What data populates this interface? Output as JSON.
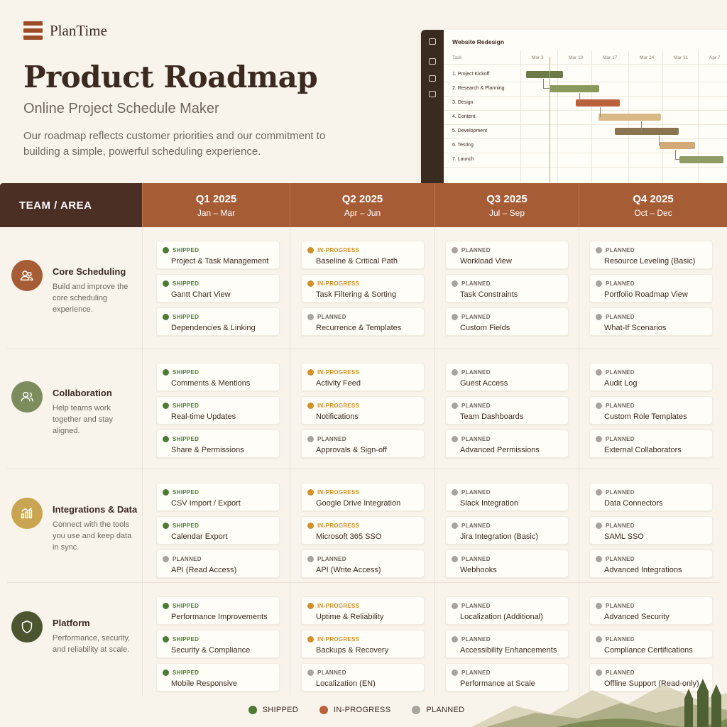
{
  "brand": {
    "name": "PlanTime"
  },
  "hero": {
    "title": "Product Roadmap",
    "subtitle": "Online Project Schedule Maker",
    "description": "Our roadmap reflects customer priorities and our commitment to building a simple, powerful scheduling experience."
  },
  "preview": {
    "title": "Website Redesign",
    "column_header": "Task",
    "dates": [
      "Mar 3",
      "Mar 10",
      "Mar 17",
      "Mar 24",
      "Mar 31",
      "Apr 7"
    ],
    "tasks": [
      "1. Project Kickoff",
      "2. Research & Planning",
      "3. Design",
      "4. Content",
      "5. Development",
      "6. Testing",
      "7. Launch"
    ],
    "bar_colors": [
      "#6d7a45",
      "#8b9a5c",
      "#b8613a",
      "#d9b985",
      "#8a744f",
      "#d4a97a",
      "#8f9c66"
    ]
  },
  "table": {
    "team_header": "TEAM / AREA",
    "quarters": [
      {
        "name": "Q1 2025",
        "range": "Jan – Mar"
      },
      {
        "name": "Q2 2025",
        "range": "Apr – Jun"
      },
      {
        "name": "Q3 2025",
        "range": "Jul – Sep"
      },
      {
        "name": "Q4 2025",
        "range": "Oct – Dec"
      }
    ],
    "areas": [
      {
        "name": "Core Scheduling",
        "desc": "Build and improve the core scheduling experience.",
        "icon": "team-icon",
        "color": "#a65d36",
        "items": [
          [
            {
              "s": "SHIPPED",
              "t": "Project & Task Management"
            },
            {
              "s": "SHIPPED",
              "t": "Gantt Chart View"
            },
            {
              "s": "SHIPPED",
              "t": "Dependencies & Linking"
            }
          ],
          [
            {
              "s": "IN-PROGRESS",
              "t": "Baseline & Critical Path"
            },
            {
              "s": "IN-PROGRESS",
              "t": "Task Filtering & Sorting"
            },
            {
              "s": "PLANNED",
              "t": "Recurrence & Templates"
            }
          ],
          [
            {
              "s": "PLANNED",
              "t": "Workload View"
            },
            {
              "s": "PLANNED",
              "t": "Task Constraints"
            },
            {
              "s": "PLANNED",
              "t": "Custom Fields"
            }
          ],
          [
            {
              "s": "PLANNED",
              "t": "Resource Leveling (Basic)"
            },
            {
              "s": "PLANNED",
              "t": "Portfolio Roadmap View"
            },
            {
              "s": "PLANNED",
              "t": "What-If Scenarios"
            }
          ]
        ]
      },
      {
        "name": "Collaboration",
        "desc": "Help teams work together and stay aligned.",
        "icon": "people-icon",
        "color": "#7c8c5c",
        "items": [
          [
            {
              "s": "SHIPPED",
              "t": "Comments & Mentions"
            },
            {
              "s": "SHIPPED",
              "t": "Real-time Updates"
            },
            {
              "s": "SHIPPED",
              "t": "Share & Permissions"
            }
          ],
          [
            {
              "s": "IN-PROGRESS",
              "t": "Activity Feed"
            },
            {
              "s": "IN-PROGRESS",
              "t": "Notifications"
            },
            {
              "s": "PLANNED",
              "t": "Approvals & Sign-off"
            }
          ],
          [
            {
              "s": "PLANNED",
              "t": "Guest Access"
            },
            {
              "s": "PLANNED",
              "t": "Team Dashboards"
            },
            {
              "s": "PLANNED",
              "t": "Advanced Permissions"
            }
          ],
          [
            {
              "s": "PLANNED",
              "t": "Audit Log"
            },
            {
              "s": "PLANNED",
              "t": "Custom Role Templates"
            },
            {
              "s": "PLANNED",
              "t": "External Collaborators"
            }
          ]
        ]
      },
      {
        "name": "Integrations & Data",
        "desc": "Connect with the tools you use and keep data in sync.",
        "icon": "chart-icon",
        "color": "#c9a552",
        "items": [
          [
            {
              "s": "SHIPPED",
              "t": "CSV Import / Export"
            },
            {
              "s": "SHIPPED",
              "t": "Calendar Export"
            },
            {
              "s": "PLANNED",
              "t": "API (Read Access)"
            }
          ],
          [
            {
              "s": "IN-PROGRESS",
              "t": "Google Drive Integration"
            },
            {
              "s": "IN-PROGRESS",
              "t": "Microsoft 365 SSO"
            },
            {
              "s": "PLANNED",
              "t": "API (Write Access)"
            }
          ],
          [
            {
              "s": "PLANNED",
              "t": "Slack Integration"
            },
            {
              "s": "PLANNED",
              "t": "Jira Integration (Basic)"
            },
            {
              "s": "PLANNED",
              "t": "Webhooks"
            }
          ],
          [
            {
              "s": "PLANNED",
              "t": "Data Connectors"
            },
            {
              "s": "PLANNED",
              "t": "SAML SSO"
            },
            {
              "s": "PLANNED",
              "t": "Advanced Integrations"
            }
          ]
        ]
      },
      {
        "name": "Platform",
        "desc": "Performance, security, and reliability at scale.",
        "icon": "shield-icon",
        "color": "#4b5530",
        "items": [
          [
            {
              "s": "SHIPPED",
              "t": "Performance Improvements"
            },
            {
              "s": "SHIPPED",
              "t": "Security & Compliance"
            },
            {
              "s": "SHIPPED",
              "t": "Mobile Responsive"
            }
          ],
          [
            {
              "s": "IN-PROGRESS",
              "t": "Uptime & Reliability"
            },
            {
              "s": "IN-PROGRESS",
              "t": "Backups & Recovery"
            },
            {
              "s": "PLANNED",
              "t": "Localization (EN)"
            }
          ],
          [
            {
              "s": "PLANNED",
              "t": "Localization (Additional)"
            },
            {
              "s": "PLANNED",
              "t": "Accessibility Enhancements"
            },
            {
              "s": "PLANNED",
              "t": "Performance at Scale"
            }
          ],
          [
            {
              "s": "PLANNED",
              "t": "Advanced Security"
            },
            {
              "s": "PLANNED",
              "t": "Compliance Certifications"
            },
            {
              "s": "PLANNED",
              "t": "Offline Support (Read-only)"
            }
          ]
        ]
      }
    ]
  },
  "legend": [
    {
      "label": "SHIPPED",
      "color": "#4e7a34"
    },
    {
      "label": "IN-PROGRESS",
      "color": "#b8613a"
    },
    {
      "label": "PLANNED",
      "color": "#a8a39d"
    }
  ]
}
